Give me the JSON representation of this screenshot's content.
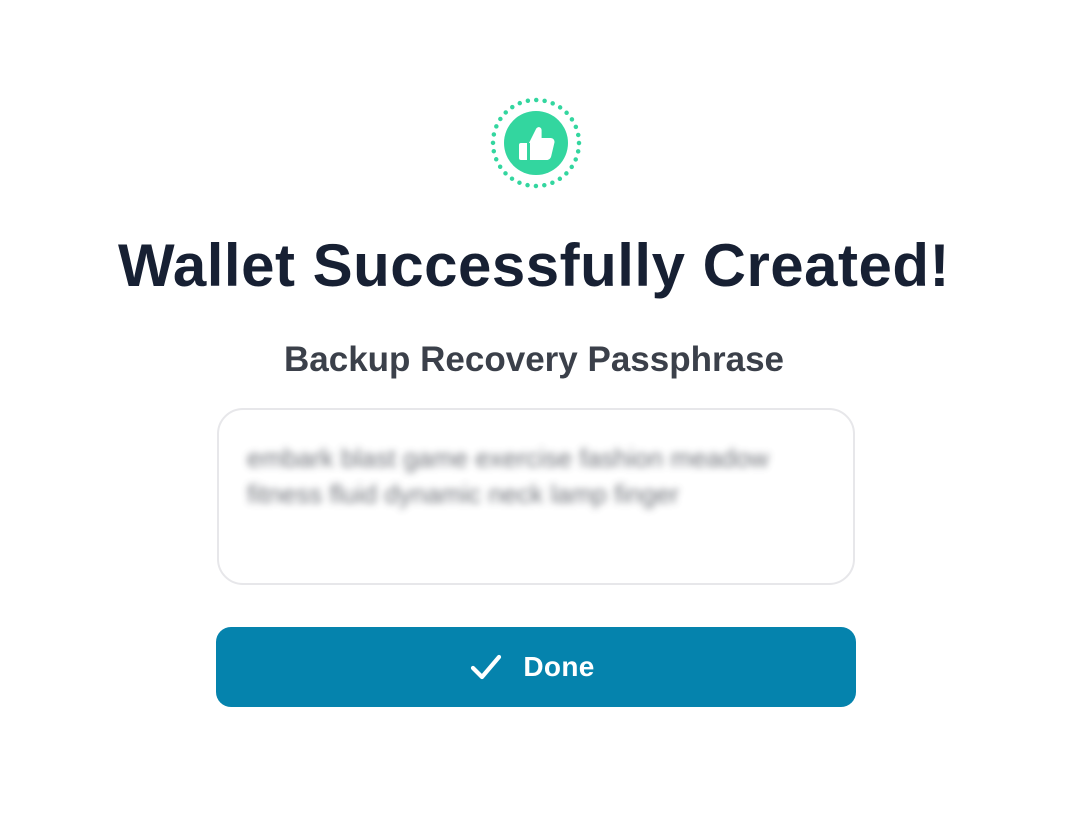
{
  "status_icon": "thumbs-up-icon",
  "title": "Wallet Successfully Created!",
  "subtitle": "Backup Recovery Passphrase",
  "passphrase": "embark blast game exercise fashion meadow fitness fluid dynamic neck lamp finger",
  "passphrase_blurred": true,
  "done_button": {
    "label": "Done",
    "icon": "check-icon"
  },
  "colors": {
    "accent_green": "#33d69f",
    "button_blue": "#0583ad",
    "title_text": "#172033"
  }
}
